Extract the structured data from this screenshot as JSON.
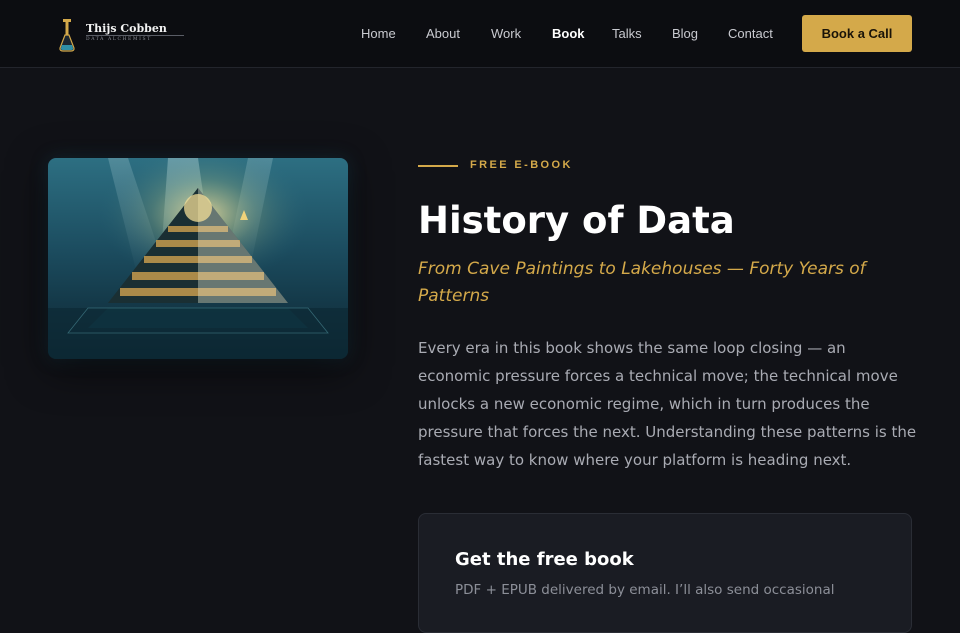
{
  "brand": {
    "name": "Thijs Cobben",
    "tagline": "DATA ALCHEMIST",
    "logo_icon": "flask-icon",
    "accent_color": "#d4a94a"
  },
  "nav": {
    "links": [
      {
        "label": "Home",
        "active": false
      },
      {
        "label": "About",
        "active": false
      },
      {
        "label": "Work",
        "active": false
      },
      {
        "label": "Book",
        "active": true
      },
      {
        "label": "Talks",
        "active": false
      },
      {
        "label": "Blog",
        "active": false
      },
      {
        "label": "Contact",
        "active": false
      }
    ],
    "cta_label": "Book a Call"
  },
  "hero": {
    "image_subject": "underwater-pyramid-illustration",
    "eyebrow": "FREE E-BOOK",
    "title": "History of Data",
    "subtitle": "From Cave Paintings to Lakehouses — Forty Years of Patterns",
    "body": "Every era in this book shows the same loop closing — an economic pressure forces a technical move; the technical move unlocks a new economic regime, which in turn produces the pressure that forces the next. Understanding these patterns is the fastest way to know where your platform is heading next."
  },
  "signup_card": {
    "title": "Get the free book",
    "description": "PDF + EPUB delivered by email. I’ll also send occasional"
  }
}
